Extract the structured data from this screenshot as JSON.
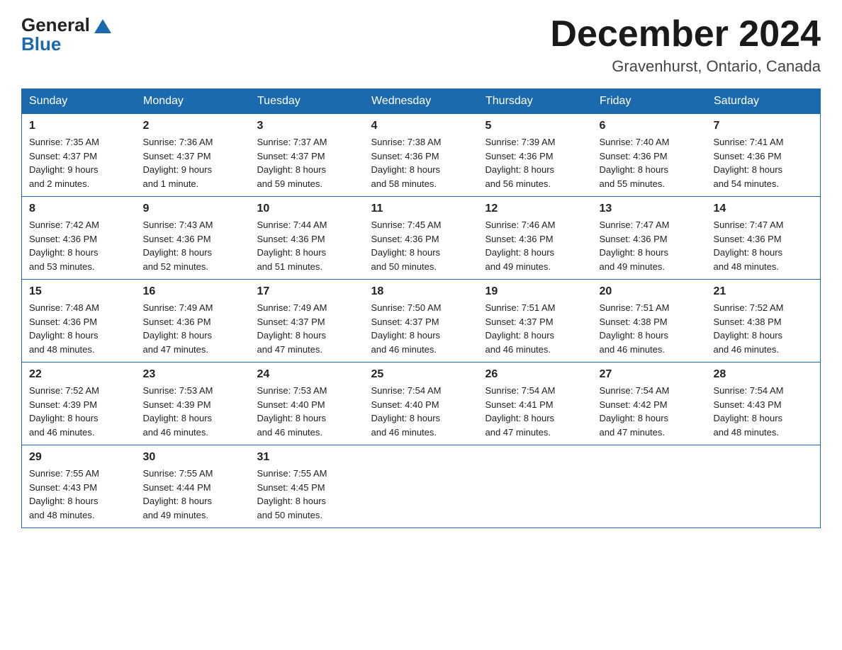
{
  "logo": {
    "general": "General",
    "triangle_alt": "arrow",
    "blue": "Blue"
  },
  "header": {
    "month_year": "December 2024",
    "location": "Gravenhurst, Ontario, Canada"
  },
  "weekdays": [
    "Sunday",
    "Monday",
    "Tuesday",
    "Wednesday",
    "Thursday",
    "Friday",
    "Saturday"
  ],
  "weeks": [
    [
      {
        "day": "1",
        "sunrise": "7:35 AM",
        "sunset": "4:37 PM",
        "daylight": "9 hours and 2 minutes."
      },
      {
        "day": "2",
        "sunrise": "7:36 AM",
        "sunset": "4:37 PM",
        "daylight": "9 hours and 1 minute."
      },
      {
        "day": "3",
        "sunrise": "7:37 AM",
        "sunset": "4:37 PM",
        "daylight": "8 hours and 59 minutes."
      },
      {
        "day": "4",
        "sunrise": "7:38 AM",
        "sunset": "4:36 PM",
        "daylight": "8 hours and 58 minutes."
      },
      {
        "day": "5",
        "sunrise": "7:39 AM",
        "sunset": "4:36 PM",
        "daylight": "8 hours and 56 minutes."
      },
      {
        "day": "6",
        "sunrise": "7:40 AM",
        "sunset": "4:36 PM",
        "daylight": "8 hours and 55 minutes."
      },
      {
        "day": "7",
        "sunrise": "7:41 AM",
        "sunset": "4:36 PM",
        "daylight": "8 hours and 54 minutes."
      }
    ],
    [
      {
        "day": "8",
        "sunrise": "7:42 AM",
        "sunset": "4:36 PM",
        "daylight": "8 hours and 53 minutes."
      },
      {
        "day": "9",
        "sunrise": "7:43 AM",
        "sunset": "4:36 PM",
        "daylight": "8 hours and 52 minutes."
      },
      {
        "day": "10",
        "sunrise": "7:44 AM",
        "sunset": "4:36 PM",
        "daylight": "8 hours and 51 minutes."
      },
      {
        "day": "11",
        "sunrise": "7:45 AM",
        "sunset": "4:36 PM",
        "daylight": "8 hours and 50 minutes."
      },
      {
        "day": "12",
        "sunrise": "7:46 AM",
        "sunset": "4:36 PM",
        "daylight": "8 hours and 49 minutes."
      },
      {
        "day": "13",
        "sunrise": "7:47 AM",
        "sunset": "4:36 PM",
        "daylight": "8 hours and 49 minutes."
      },
      {
        "day": "14",
        "sunrise": "7:47 AM",
        "sunset": "4:36 PM",
        "daylight": "8 hours and 48 minutes."
      }
    ],
    [
      {
        "day": "15",
        "sunrise": "7:48 AM",
        "sunset": "4:36 PM",
        "daylight": "8 hours and 48 minutes."
      },
      {
        "day": "16",
        "sunrise": "7:49 AM",
        "sunset": "4:36 PM",
        "daylight": "8 hours and 47 minutes."
      },
      {
        "day": "17",
        "sunrise": "7:49 AM",
        "sunset": "4:37 PM",
        "daylight": "8 hours and 47 minutes."
      },
      {
        "day": "18",
        "sunrise": "7:50 AM",
        "sunset": "4:37 PM",
        "daylight": "8 hours and 46 minutes."
      },
      {
        "day": "19",
        "sunrise": "7:51 AM",
        "sunset": "4:37 PM",
        "daylight": "8 hours and 46 minutes."
      },
      {
        "day": "20",
        "sunrise": "7:51 AM",
        "sunset": "4:38 PM",
        "daylight": "8 hours and 46 minutes."
      },
      {
        "day": "21",
        "sunrise": "7:52 AM",
        "sunset": "4:38 PM",
        "daylight": "8 hours and 46 minutes."
      }
    ],
    [
      {
        "day": "22",
        "sunrise": "7:52 AM",
        "sunset": "4:39 PM",
        "daylight": "8 hours and 46 minutes."
      },
      {
        "day": "23",
        "sunrise": "7:53 AM",
        "sunset": "4:39 PM",
        "daylight": "8 hours and 46 minutes."
      },
      {
        "day": "24",
        "sunrise": "7:53 AM",
        "sunset": "4:40 PM",
        "daylight": "8 hours and 46 minutes."
      },
      {
        "day": "25",
        "sunrise": "7:54 AM",
        "sunset": "4:40 PM",
        "daylight": "8 hours and 46 minutes."
      },
      {
        "day": "26",
        "sunrise": "7:54 AM",
        "sunset": "4:41 PM",
        "daylight": "8 hours and 47 minutes."
      },
      {
        "day": "27",
        "sunrise": "7:54 AM",
        "sunset": "4:42 PM",
        "daylight": "8 hours and 47 minutes."
      },
      {
        "day": "28",
        "sunrise": "7:54 AM",
        "sunset": "4:43 PM",
        "daylight": "8 hours and 48 minutes."
      }
    ],
    [
      {
        "day": "29",
        "sunrise": "7:55 AM",
        "sunset": "4:43 PM",
        "daylight": "8 hours and 48 minutes."
      },
      {
        "day": "30",
        "sunrise": "7:55 AM",
        "sunset": "4:44 PM",
        "daylight": "8 hours and 49 minutes."
      },
      {
        "day": "31",
        "sunrise": "7:55 AM",
        "sunset": "4:45 PM",
        "daylight": "8 hours and 50 minutes."
      },
      null,
      null,
      null,
      null
    ]
  ],
  "labels": {
    "sunrise_prefix": "Sunrise: ",
    "sunset_prefix": "Sunset: ",
    "daylight_prefix": "Daylight: "
  }
}
